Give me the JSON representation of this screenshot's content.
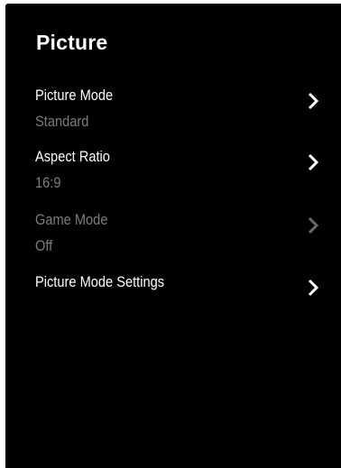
{
  "panel": {
    "title": "Picture"
  },
  "menu": {
    "items": [
      {
        "label": "Picture Mode",
        "value": "Standard",
        "enabled": true,
        "icon": "chevron-right-icon"
      },
      {
        "label": "Aspect Ratio",
        "value": "16:9",
        "enabled": true,
        "icon": "chevron-right-icon"
      },
      {
        "label": "Game Mode",
        "value": "Off",
        "enabled": false,
        "icon": "chevron-right-icon"
      },
      {
        "label": "Picture Mode Settings",
        "value": "",
        "enabled": true,
        "icon": "chevron-right-icon"
      }
    ]
  },
  "colors": {
    "background": "#000000",
    "text": "#ffffff",
    "secondary_text": "#7c7c7c",
    "chevron_enabled": "#ffffff",
    "chevron_disabled": "#6a6a6a"
  }
}
